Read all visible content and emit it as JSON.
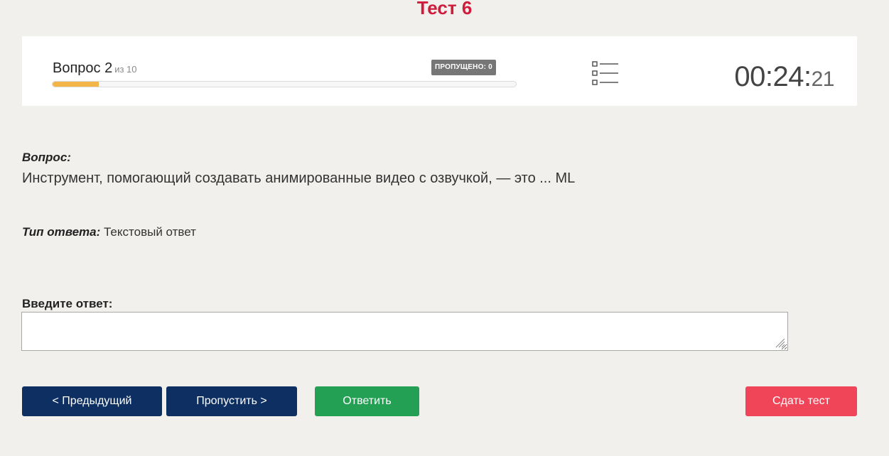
{
  "test": {
    "title": "Тест 6"
  },
  "status": {
    "question_label": "Вопрос 2",
    "question_of": "из 10",
    "skipped_badge": "ПРОПУЩЕНО: 0",
    "progress_fraction": 0.1,
    "list_icon": "list-icon",
    "timer_main": "00:24:",
    "timer_seconds": "21"
  },
  "question": {
    "label": "Вопрос:",
    "text": "Инструмент, помогающий создавать анимированные видео с озвучкой, — это ... ML"
  },
  "answer_type": {
    "label": "Тип ответа:",
    "value": "Текстовый ответ"
  },
  "answer_input": {
    "label": "Введите ответ:",
    "value": "",
    "placeholder": ""
  },
  "buttons": {
    "prev": "< Предыдущий",
    "skip": "Пропустить >",
    "answer": "Ответить",
    "submit": "Сдать тест"
  },
  "colors": {
    "title": "#d01c3c",
    "progress": "#f3b548",
    "nav_button": "#0d2f62",
    "answer_button": "#24a055",
    "submit_button": "#f04559",
    "badge": "#767676"
  }
}
